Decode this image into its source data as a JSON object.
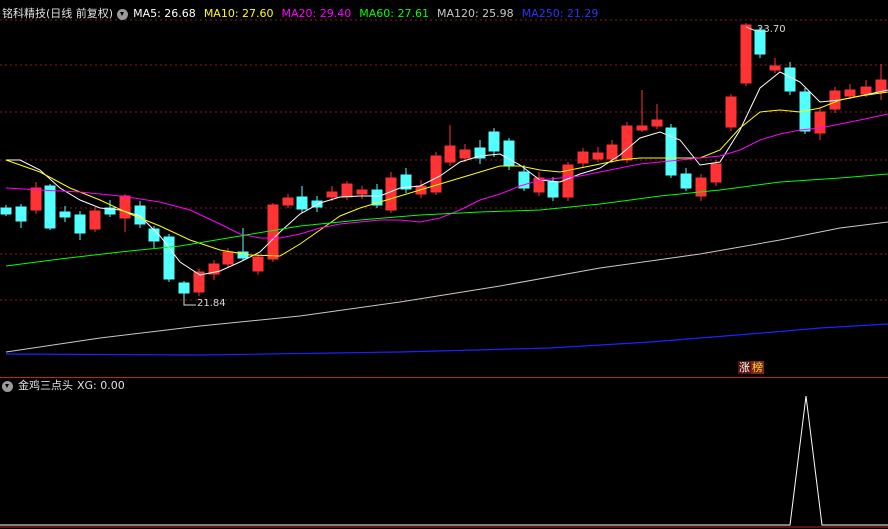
{
  "main": {
    "title": "铭科精技(日线 前复权)",
    "indicators": [
      {
        "label": "MA5: 26.68",
        "color": "#ffffff"
      },
      {
        "label": "MA10: 27.60",
        "color": "#ffff00"
      },
      {
        "label": "MA20: 29.40",
        "color": "#ff00ff"
      },
      {
        "label": "MA60: 27.61",
        "color": "#00ff00"
      },
      {
        "label": "MA120: 25.98",
        "color": "#c8c8c8"
      },
      {
        "label": "MA250: 21.29",
        "color": "#3030ff"
      }
    ],
    "high_label": "23.70",
    "low_label": "21.84",
    "badge": [
      "涨",
      "榜"
    ]
  },
  "sub": {
    "title": "金鸡三点头",
    "value_label": "XG: 0.00"
  },
  "colors": {
    "up": "#ff3333",
    "down": "#54ffff",
    "grid": "#8b1a1a",
    "axis": "#c02020"
  }
}
